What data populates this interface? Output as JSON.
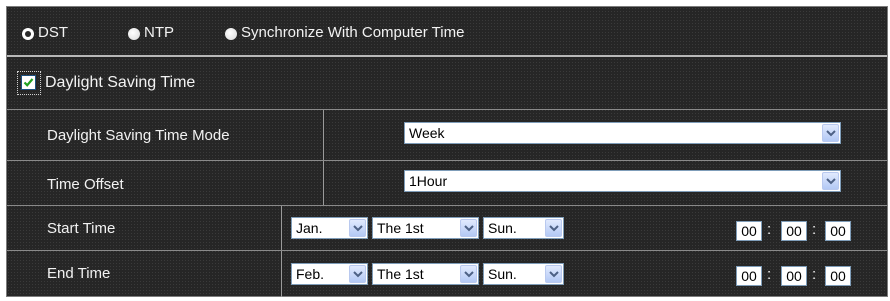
{
  "sync_modes": {
    "dst_label": "DST",
    "ntp_label": "NTP",
    "computer_label": "Synchronize With Computer Time",
    "selected": "DST"
  },
  "dst_section": {
    "checkbox_label": "Daylight Saving Time",
    "checked": true
  },
  "dst_mode": {
    "label": "Daylight Saving Time Mode",
    "value": "Week"
  },
  "time_offset": {
    "label": "Time Offset",
    "value": "1Hour"
  },
  "start_time": {
    "label": "Start Time",
    "month": "Jan.",
    "week": "The 1st",
    "day": "Sun.",
    "hour": "00",
    "minute": "00",
    "second": "00"
  },
  "end_time": {
    "label": "End Time",
    "month": "Feb.",
    "week": "The 1st",
    "day": "Sun.",
    "hour": "00",
    "minute": "00",
    "second": "00"
  },
  "separators": {
    "colon": ":"
  },
  "icons": {
    "dropdown": "chevron-down-icon",
    "check": "checkmark-icon"
  }
}
